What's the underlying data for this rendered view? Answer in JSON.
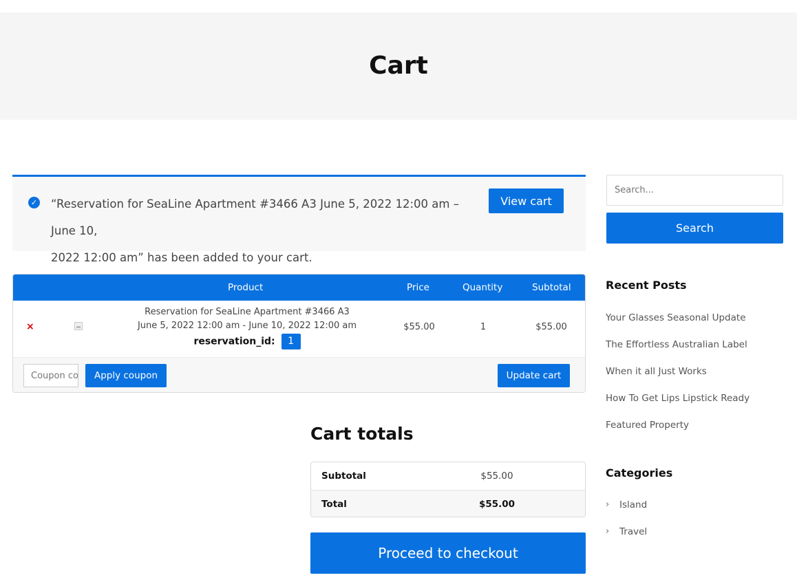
{
  "page": {
    "title": "Cart"
  },
  "notice": {
    "line1": "“Reservation for SeaLine Apartment #3466 A3 June 5, 2022 12:00 am – June 10,",
    "line2": "2022 12:00 am” has been added to your cart.",
    "button": "View cart"
  },
  "cart": {
    "headers": {
      "product": "Product",
      "price": "Price",
      "quantity": "Quantity",
      "subtotal": "Subtotal"
    },
    "item": {
      "remove": "×",
      "name": "Reservation for SeaLine Apartment #3466 A3",
      "dates": "June 5, 2022 12:00 am - June 10, 2022 12:00 am",
      "meta_label": "reservation_id:",
      "meta_value": "1",
      "price": "$55.00",
      "quantity": "1",
      "subtotal": "$55.00"
    },
    "coupon_placeholder": "Coupon code",
    "apply_button": "Apply coupon",
    "update_button": "Update cart"
  },
  "totals": {
    "title": "Cart totals",
    "subtotal_label": "Subtotal",
    "subtotal_value": "$55.00",
    "total_label": "Total",
    "total_value": "$55.00",
    "checkout_button": "Proceed to checkout"
  },
  "sidebar": {
    "search_placeholder": "Search...",
    "search_button": "Search",
    "recent_title": "Recent Posts",
    "recent_posts": [
      "Your Glasses Seasonal Update",
      "The Effortless Australian Label",
      "When it all Just Works",
      "How To Get Lips Lipstick Ready",
      "Featured Property"
    ],
    "categories_title": "Categories",
    "categories": [
      "Island",
      "Travel"
    ],
    "chevron": "›"
  },
  "colors": {
    "accent": "#0a72e0",
    "remove": "#dd0000",
    "panel": "#f7f7f7"
  }
}
